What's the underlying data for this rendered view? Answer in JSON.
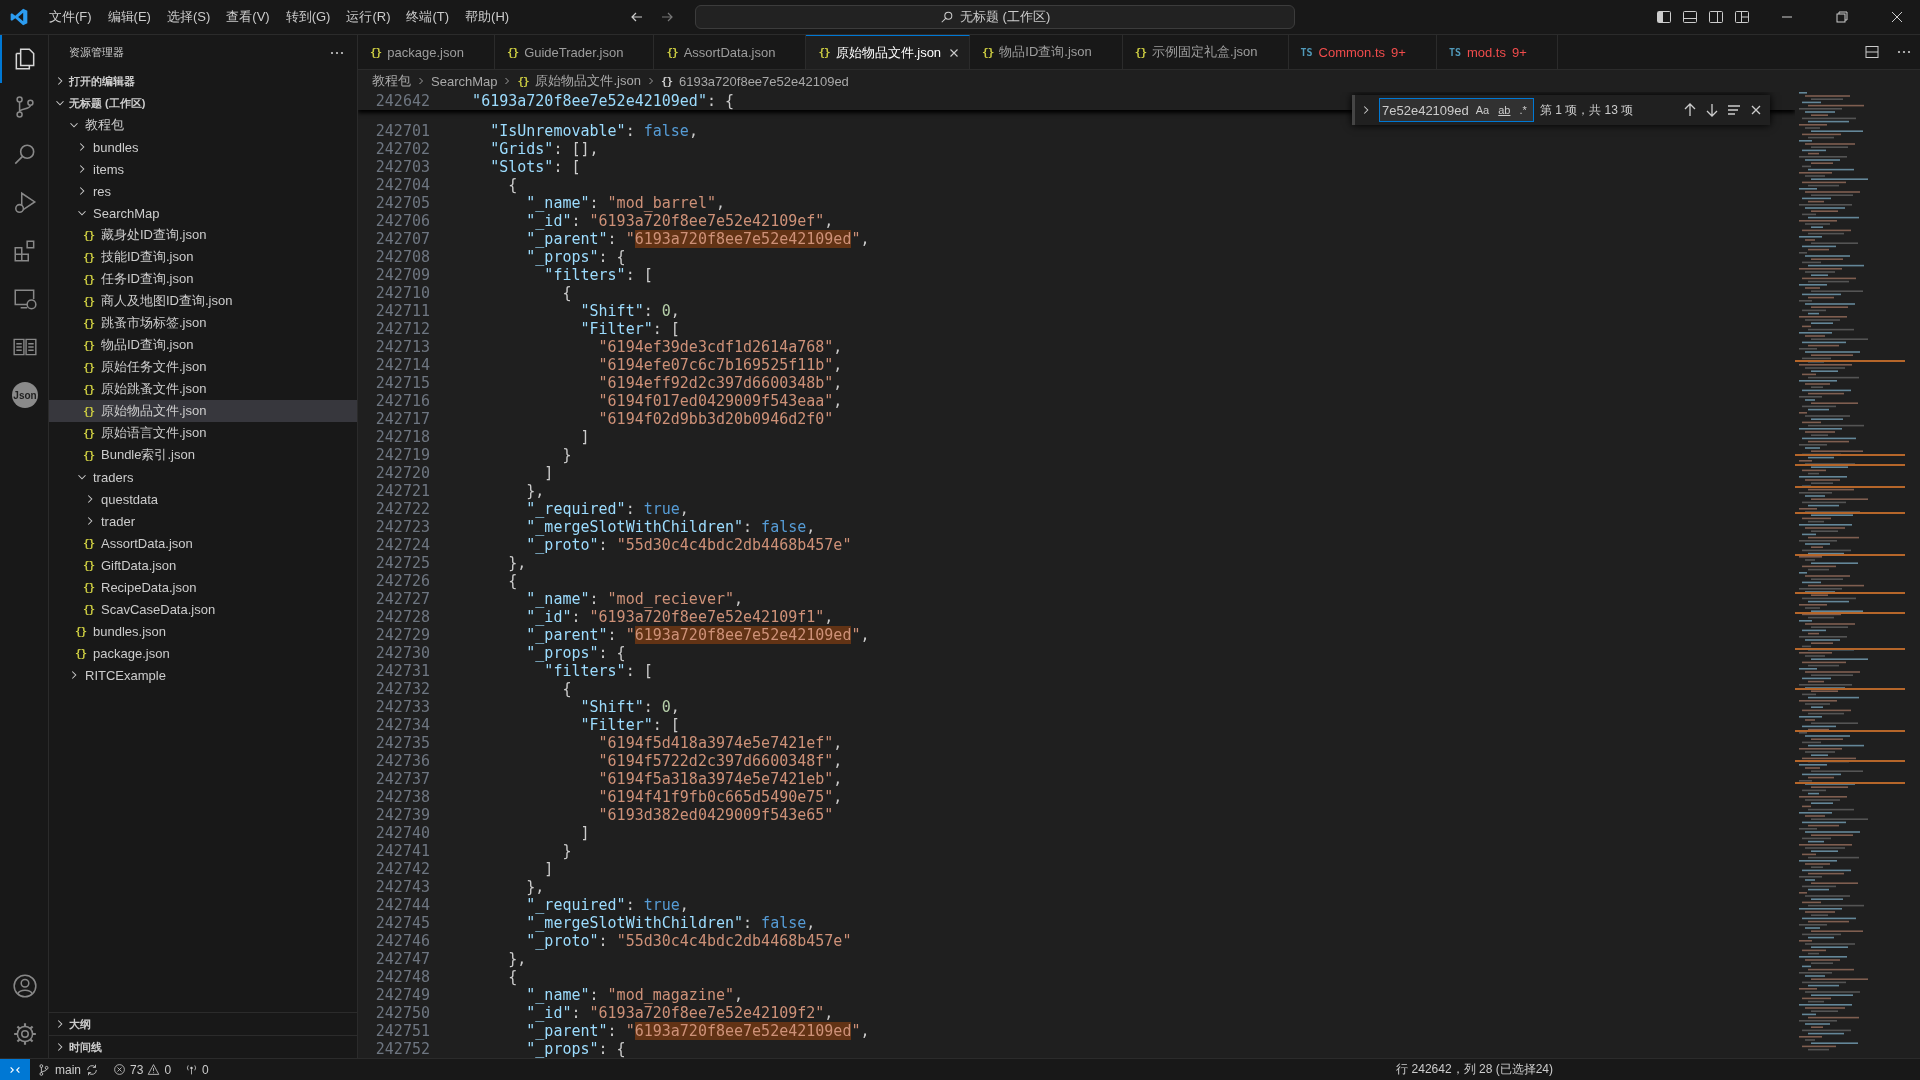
{
  "title_bar": {
    "menus": [
      "文件(F)",
      "编辑(E)",
      "选择(S)",
      "查看(V)",
      "转到(G)",
      "运行(R)",
      "终端(T)",
      "帮助(H)"
    ],
    "command_center": "无标题 (工作区)"
  },
  "activity_bar": {
    "items": [
      {
        "kind": "explorer",
        "selected": true
      },
      {
        "kind": "source-control",
        "selected": false
      },
      {
        "kind": "search",
        "selected": false
      },
      {
        "kind": "run",
        "selected": false
      },
      {
        "kind": "extensions",
        "selected": false
      },
      {
        "kind": "remote",
        "selected": false
      },
      {
        "kind": "book",
        "selected": false
      },
      {
        "kind": "json",
        "selected": false,
        "label": "Json"
      }
    ]
  },
  "sidebar": {
    "title": "资源管理器",
    "sections": [
      {
        "label": "打开的编辑器",
        "expanded": false
      },
      {
        "label": "无标题 (工作区)",
        "expanded": true,
        "tree": [
          {
            "label": "教程包",
            "kind": "folder",
            "expanded": true,
            "selected": false,
            "children": [
              {
                "label": "bundles",
                "kind": "folder",
                "expanded": false,
                "selected": false
              },
              {
                "label": "items",
                "kind": "folder",
                "expanded": false,
                "selected": false
              },
              {
                "label": "res",
                "kind": "folder",
                "expanded": false,
                "selected": false
              },
              {
                "label": "SearchMap",
                "kind": "folder",
                "expanded": true,
                "selected": false,
                "children": [
                  {
                    "label": "藏身处ID查询.json",
                    "kind": "file",
                    "icon": "{}",
                    "selected": false
                  },
                  {
                    "label": "技能ID查询.json",
                    "kind": "file",
                    "icon": "{}",
                    "selected": false
                  },
                  {
                    "label": "任务ID查询.json",
                    "kind": "file",
                    "icon": "{}",
                    "selected": false
                  },
                  {
                    "label": "商人及地图ID查询.json",
                    "kind": "file",
                    "icon": "{}",
                    "selected": false
                  },
                  {
                    "label": "跳蚤市场标签.json",
                    "kind": "file",
                    "icon": "{}",
                    "selected": false
                  },
                  {
                    "label": "物品ID查询.json",
                    "kind": "file",
                    "icon": "{}",
                    "selected": false
                  },
                  {
                    "label": "原始任务文件.json",
                    "kind": "file",
                    "icon": "{}",
                    "selected": false
                  },
                  {
                    "label": "原始跳蚤文件.json",
                    "kind": "file",
                    "icon": "{}",
                    "selected": false
                  },
                  {
                    "label": "原始物品文件.json",
                    "kind": "file",
                    "icon": "{}",
                    "selected": true
                  },
                  {
                    "label": "原始语言文件.json",
                    "kind": "file",
                    "icon": "{}",
                    "selected": false
                  },
                  {
                    "label": "Bundle索引.json",
                    "kind": "file",
                    "icon": "{}",
                    "selected": false
                  }
                ]
              },
              {
                "label": "traders",
                "kind": "folder",
                "expanded": true,
                "selected": false,
                "children": [
                  {
                    "label": "questdata",
                    "kind": "folder",
                    "expanded": false,
                    "selected": false
                  },
                  {
                    "label": "trader",
                    "kind": "folder",
                    "expanded": false,
                    "selected": false
                  },
                  {
                    "label": "AssortData.json",
                    "kind": "file",
                    "icon": "{}",
                    "selected": false
                  },
                  {
                    "label": "GiftData.json",
                    "kind": "file",
                    "icon": "{}",
                    "selected": false
                  },
                  {
                    "label": "RecipeData.json",
                    "kind": "file",
                    "icon": "{}",
                    "selected": false
                  },
                  {
                    "label": "ScavCaseData.json",
                    "kind": "file",
                    "icon": "{}",
                    "selected": false
                  }
                ]
              },
              {
                "label": "bundles.json",
                "kind": "file",
                "icon": "{}",
                "selected": false
              },
              {
                "label": "package.json",
                "kind": "file",
                "icon": "{}",
                "selected": false
              }
            ]
          },
          {
            "label": "RITCExample",
            "kind": "folder",
            "expanded": false,
            "selected": false
          }
        ]
      }
    ],
    "bottom_sections": [
      {
        "label": "大纲",
        "expanded": false
      },
      {
        "label": "时间线",
        "expanded": false
      }
    ]
  },
  "tabs": [
    {
      "label": "package.json",
      "icon": "{}",
      "kind": "json",
      "selected": false
    },
    {
      "label": "GuideTrader.json",
      "icon": "{}",
      "kind": "json",
      "selected": false
    },
    {
      "label": "AssortData.json",
      "icon": "{}",
      "kind": "json",
      "selected": false
    },
    {
      "label": "原始物品文件.json",
      "icon": "{}",
      "kind": "json",
      "selected": true
    },
    {
      "label": "物品ID查询.json",
      "icon": "{}",
      "kind": "json",
      "selected": false
    },
    {
      "label": "示例固定礼盒.json",
      "icon": "{}",
      "kind": "json",
      "selected": false
    },
    {
      "label": "Common.ts",
      "icon": "TS",
      "kind": "ts",
      "selected": false,
      "problems": "9+"
    },
    {
      "label": "mod.ts",
      "icon": "TS",
      "kind": "ts",
      "selected": false,
      "problems": "9+"
    }
  ],
  "breadcrumbs": [
    {
      "label": "教程包"
    },
    {
      "label": "SearchMap"
    },
    {
      "label": "原始物品文件.json",
      "icon": "{}"
    },
    {
      "label": "6193a720f8ee7e52e42109ed",
      "icon": "{}"
    }
  ],
  "sticky_line": {
    "n": "242642",
    "t": [
      {
        "kind": "key",
        "text": "    \"6193a720f8ee7e52e42109ed\""
      },
      {
        "kind": "punct",
        "text": ": {"
      }
    ]
  },
  "lines": [
    {
      "n": "242701",
      "t": [
        {
          "kind": "key",
          "text": "      \"IsUnremovable\""
        },
        {
          "kind": "punct",
          "text": ": "
        },
        {
          "kind": "bool",
          "text": "false"
        },
        {
          "kind": "punct",
          "text": ","
        }
      ]
    },
    {
      "n": "242702",
      "t": [
        {
          "kind": "key",
          "text": "      \"Grids\""
        },
        {
          "kind": "punct",
          "text": ": [],"
        }
      ]
    },
    {
      "n": "242703",
      "t": [
        {
          "kind": "key",
          "text": "      \"Slots\""
        },
        {
          "kind": "punct",
          "text": ": ["
        }
      ]
    },
    {
      "n": "242704",
      "t": [
        {
          "kind": "punct",
          "text": "        {"
        }
      ]
    },
    {
      "n": "242705",
      "t": [
        {
          "kind": "key",
          "text": "          \"_name\""
        },
        {
          "kind": "punct",
          "text": ": "
        },
        {
          "kind": "str",
          "text": "\"mod_barrel\""
        },
        {
          "kind": "punct",
          "text": ","
        }
      ]
    },
    {
      "n": "242706",
      "t": [
        {
          "kind": "key",
          "text": "          \"_id\""
        },
        {
          "kind": "punct",
          "text": ": "
        },
        {
          "kind": "str",
          "text": "\"6193a720f8ee7e52e42109ef\""
        },
        {
          "kind": "punct",
          "text": ","
        }
      ]
    },
    {
      "n": "242707",
      "t": [
        {
          "kind": "key",
          "text": "          \"_parent\""
        },
        {
          "kind": "punct",
          "text": ": "
        },
        {
          "kind": "str",
          "text": "\""
        },
        {
          "kind": "match",
          "text": "6193a720f8ee7e52e42109ed"
        },
        {
          "kind": "str",
          "text": "\""
        },
        {
          "kind": "punct",
          "text": ","
        }
      ]
    },
    {
      "n": "242708",
      "t": [
        {
          "kind": "key",
          "text": "          \"_props\""
        },
        {
          "kind": "punct",
          "text": ": {"
        }
      ]
    },
    {
      "n": "242709",
      "t": [
        {
          "kind": "key",
          "text": "            \"filters\""
        },
        {
          "kind": "punct",
          "text": ": ["
        }
      ]
    },
    {
      "n": "242710",
      "t": [
        {
          "kind": "punct",
          "text": "              {"
        }
      ]
    },
    {
      "n": "242711",
      "t": [
        {
          "kind": "key",
          "text": "                \"Shift\""
        },
        {
          "kind": "punct",
          "text": ": "
        },
        {
          "kind": "num",
          "text": "0"
        },
        {
          "kind": "punct",
          "text": ","
        }
      ]
    },
    {
      "n": "242712",
      "t": [
        {
          "kind": "key",
          "text": "                \"Filter\""
        },
        {
          "kind": "punct",
          "text": ": ["
        }
      ]
    },
    {
      "n": "242713",
      "t": [
        {
          "kind": "str",
          "text": "                  \"6194ef39de3cdf1d2614a768\""
        },
        {
          "kind": "punct",
          "text": ","
        }
      ]
    },
    {
      "n": "242714",
      "t": [
        {
          "kind": "str",
          "text": "                  \"6194efe07c6c7b169525f11b\""
        },
        {
          "kind": "punct",
          "text": ","
        }
      ]
    },
    {
      "n": "242715",
      "t": [
        {
          "kind": "str",
          "text": "                  \"6194eff92d2c397d6600348b\""
        },
        {
          "kind": "punct",
          "text": ","
        }
      ]
    },
    {
      "n": "242716",
      "t": [
        {
          "kind": "str",
          "text": "                  \"6194f017ed0429009f543eaa\""
        },
        {
          "kind": "punct",
          "text": ","
        }
      ]
    },
    {
      "n": "242717",
      "t": [
        {
          "kind": "str",
          "text": "                  \"6194f02d9bb3d20b0946d2f0\""
        }
      ]
    },
    {
      "n": "242718",
      "t": [
        {
          "kind": "punct",
          "text": "                ]"
        }
      ]
    },
    {
      "n": "242719",
      "t": [
        {
          "kind": "punct",
          "text": "              }"
        }
      ]
    },
    {
      "n": "242720",
      "t": [
        {
          "kind": "punct",
          "text": "            ]"
        }
      ]
    },
    {
      "n": "242721",
      "t": [
        {
          "kind": "punct",
          "text": "          },"
        }
      ]
    },
    {
      "n": "242722",
      "t": [
        {
          "kind": "key",
          "text": "          \"_required\""
        },
        {
          "kind": "punct",
          "text": ": "
        },
        {
          "kind": "bool",
          "text": "true"
        },
        {
          "kind": "punct",
          "text": ","
        }
      ]
    },
    {
      "n": "242723",
      "t": [
        {
          "kind": "key",
          "text": "          \"_mergeSlotWithChildren\""
        },
        {
          "kind": "punct",
          "text": ": "
        },
        {
          "kind": "bool",
          "text": "false"
        },
        {
          "kind": "punct",
          "text": ","
        }
      ]
    },
    {
      "n": "242724",
      "t": [
        {
          "kind": "key",
          "text": "          \"_proto\""
        },
        {
          "kind": "punct",
          "text": ": "
        },
        {
          "kind": "str",
          "text": "\"55d30c4c4bdc2db4468b457e\""
        }
      ]
    },
    {
      "n": "242725",
      "t": [
        {
          "kind": "punct",
          "text": "        },"
        }
      ]
    },
    {
      "n": "242726",
      "t": [
        {
          "kind": "punct",
          "text": "        {"
        }
      ]
    },
    {
      "n": "242727",
      "t": [
        {
          "kind": "key",
          "text": "          \"_name\""
        },
        {
          "kind": "punct",
          "text": ": "
        },
        {
          "kind": "str",
          "text": "\"mod_reciever\""
        },
        {
          "kind": "punct",
          "text": ","
        }
      ]
    },
    {
      "n": "242728",
      "t": [
        {
          "kind": "key",
          "text": "          \"_id\""
        },
        {
          "kind": "punct",
          "text": ": "
        },
        {
          "kind": "str",
          "text": "\"6193a720f8ee7e52e42109f1\""
        },
        {
          "kind": "punct",
          "text": ","
        }
      ]
    },
    {
      "n": "242729",
      "t": [
        {
          "kind": "key",
          "text": "          \"_parent\""
        },
        {
          "kind": "punct",
          "text": ": "
        },
        {
          "kind": "str",
          "text": "\""
        },
        {
          "kind": "match",
          "text": "6193a720f8ee7e52e42109ed"
        },
        {
          "kind": "str",
          "text": "\""
        },
        {
          "kind": "punct",
          "text": ","
        }
      ]
    },
    {
      "n": "242730",
      "t": [
        {
          "kind": "key",
          "text": "          \"_props\""
        },
        {
          "kind": "punct",
          "text": ": {"
        }
      ]
    },
    {
      "n": "242731",
      "t": [
        {
          "kind": "key",
          "text": "            \"filters\""
        },
        {
          "kind": "punct",
          "text": ": ["
        }
      ]
    },
    {
      "n": "242732",
      "t": [
        {
          "kind": "punct",
          "text": "              {"
        }
      ]
    },
    {
      "n": "242733",
      "t": [
        {
          "kind": "key",
          "text": "                \"Shift\""
        },
        {
          "kind": "punct",
          "text": ": "
        },
        {
          "kind": "num",
          "text": "0"
        },
        {
          "kind": "punct",
          "text": ","
        }
      ]
    },
    {
      "n": "242734",
      "t": [
        {
          "kind": "key",
          "text": "                \"Filter\""
        },
        {
          "kind": "punct",
          "text": ": ["
        }
      ]
    },
    {
      "n": "242735",
      "t": [
        {
          "kind": "str",
          "text": "                  \"6194f5d418a3974e5e7421ef\""
        },
        {
          "kind": "punct",
          "text": ","
        }
      ]
    },
    {
      "n": "242736",
      "t": [
        {
          "kind": "str",
          "text": "                  \"6194f5722d2c397d6600348f\""
        },
        {
          "kind": "punct",
          "text": ","
        }
      ]
    },
    {
      "n": "242737",
      "t": [
        {
          "kind": "str",
          "text": "                  \"6194f5a318a3974e5e7421eb\""
        },
        {
          "kind": "punct",
          "text": ","
        }
      ]
    },
    {
      "n": "242738",
      "t": [
        {
          "kind": "str",
          "text": "                  \"6194f41f9fb0c665d5490e75\""
        },
        {
          "kind": "punct",
          "text": ","
        }
      ]
    },
    {
      "n": "242739",
      "t": [
        {
          "kind": "str",
          "text": "                  \"6193d382ed0429009f543e65\""
        }
      ]
    },
    {
      "n": "242740",
      "t": [
        {
          "kind": "punct",
          "text": "                ]"
        }
      ]
    },
    {
      "n": "242741",
      "t": [
        {
          "kind": "punct",
          "text": "              }"
        }
      ]
    },
    {
      "n": "242742",
      "t": [
        {
          "kind": "punct",
          "text": "            ]"
        }
      ]
    },
    {
      "n": "242743",
      "t": [
        {
          "kind": "punct",
          "text": "          },"
        }
      ]
    },
    {
      "n": "242744",
      "t": [
        {
          "kind": "key",
          "text": "          \"_required\""
        },
        {
          "kind": "punct",
          "text": ": "
        },
        {
          "kind": "bool",
          "text": "true"
        },
        {
          "kind": "punct",
          "text": ","
        }
      ]
    },
    {
      "n": "242745",
      "t": [
        {
          "kind": "key",
          "text": "          \"_mergeSlotWithChildren\""
        },
        {
          "kind": "punct",
          "text": ": "
        },
        {
          "kind": "bool",
          "text": "false"
        },
        {
          "kind": "punct",
          "text": ","
        }
      ]
    },
    {
      "n": "242746",
      "t": [
        {
          "kind": "key",
          "text": "          \"_proto\""
        },
        {
          "kind": "punct",
          "text": ": "
        },
        {
          "kind": "str",
          "text": "\"55d30c4c4bdc2db4468b457e\""
        }
      ]
    },
    {
      "n": "242747",
      "t": [
        {
          "kind": "punct",
          "text": "        },"
        }
      ]
    },
    {
      "n": "242748",
      "t": [
        {
          "kind": "punct",
          "text": "        {"
        }
      ]
    },
    {
      "n": "242749",
      "t": [
        {
          "kind": "key",
          "text": "          \"_name\""
        },
        {
          "kind": "punct",
          "text": ": "
        },
        {
          "kind": "str",
          "text": "\"mod_magazine\""
        },
        {
          "kind": "punct",
          "text": ","
        }
      ]
    },
    {
      "n": "242750",
      "t": [
        {
          "kind": "key",
          "text": "          \"_id\""
        },
        {
          "kind": "punct",
          "text": ": "
        },
        {
          "kind": "str",
          "text": "\"6193a720f8ee7e52e42109f2\""
        },
        {
          "kind": "punct",
          "text": ","
        }
      ]
    },
    {
      "n": "242751",
      "t": [
        {
          "kind": "key",
          "text": "          \"_parent\""
        },
        {
          "kind": "punct",
          "text": ": "
        },
        {
          "kind": "str",
          "text": "\""
        },
        {
          "kind": "match",
          "text": "6193a720f8ee7e52e42109ed"
        },
        {
          "kind": "str",
          "text": "\""
        },
        {
          "kind": "punct",
          "text": ","
        }
      ]
    },
    {
      "n": "242752",
      "t": [
        {
          "kind": "key",
          "text": "          \"_props\""
        },
        {
          "kind": "punct",
          "text": ": {"
        }
      ]
    }
  ],
  "find_widget": {
    "value": "7e52e42109ed",
    "options": [
      {
        "label": "Aa",
        "on": false
      },
      {
        "label": "ab",
        "on": false
      },
      {
        "label": ".*",
        "on": false
      }
    ],
    "result": "第 1 项，共 13 项"
  },
  "status_bar": {
    "branch": "main",
    "errors": "73",
    "warnings": "0",
    "ports": "0",
    "cursor": "行 242642，列 28 (已选择24)"
  }
}
